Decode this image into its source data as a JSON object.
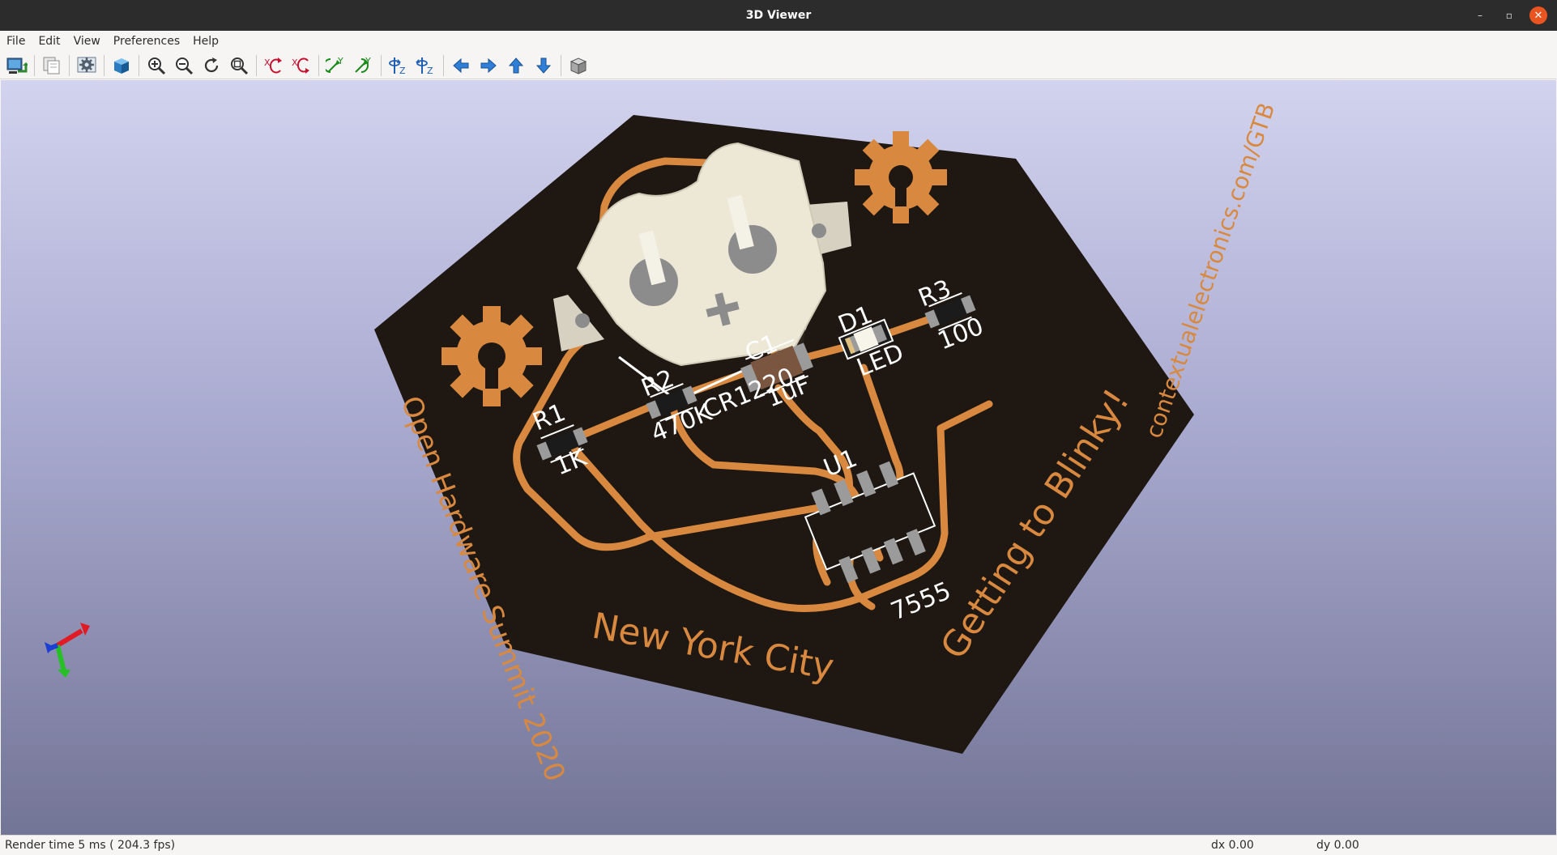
{
  "window": {
    "title": "3D Viewer",
    "minimize_glyph": "–",
    "maximize_glyph": "▫",
    "close_glyph": "✕"
  },
  "menu": [
    {
      "label": "File"
    },
    {
      "label": "Edit"
    },
    {
      "label": "View"
    },
    {
      "label": "Preferences"
    },
    {
      "label": "Help"
    }
  ],
  "toolbar": {
    "buttons": [
      {
        "icon": "reload-board-icon"
      },
      {
        "icon": "copy-image-icon"
      },
      {
        "icon": "settings-gear-icon"
      },
      {
        "icon": "raytrace-cube-icon"
      },
      {
        "icon": "zoom-in-icon"
      },
      {
        "icon": "zoom-out-icon"
      },
      {
        "icon": "refresh-icon"
      },
      {
        "icon": "zoom-fit-icon"
      },
      {
        "icon": "rotate-x-cw-icon"
      },
      {
        "icon": "rotate-x-ccw-icon"
      },
      {
        "icon": "rotate-y-cw-icon"
      },
      {
        "icon": "rotate-y-ccw-icon"
      },
      {
        "icon": "rotate-z-cw-icon"
      },
      {
        "icon": "rotate-z-ccw-icon"
      },
      {
        "icon": "move-left-icon"
      },
      {
        "icon": "move-right-icon"
      },
      {
        "icon": "move-up-icon"
      },
      {
        "icon": "move-down-icon"
      },
      {
        "icon": "ortho-view-icon"
      }
    ]
  },
  "board": {
    "silkscreen": {
      "battery_ref": "CR1220",
      "c1_ref": "C1",
      "c1_val": "1uF",
      "d1_ref": "D1",
      "d1_val": "LED",
      "r1_ref": "R1",
      "r1_val": "1K",
      "r2_ref": "R2",
      "r2_val": "470K",
      "r3_ref": "R3",
      "r3_val": "100",
      "u1_ref": "U1",
      "u1_val": "7555"
    },
    "copper_text": {
      "left": "Open Hardware Summit 2020",
      "bottom": "New York City",
      "right_bottom": "Getting to Blinky!",
      "right_top": "contextualelectronics.com/GTB"
    },
    "colors": {
      "pcb": "#1e1712",
      "copper": "#d8893f",
      "silk": "#ffffff",
      "battery_holder": "#ede8d6"
    }
  },
  "status": {
    "render": "Render time 5 ms ( 204.3 fps)",
    "dx": "dx 0.00",
    "dy": "dy 0.00"
  }
}
